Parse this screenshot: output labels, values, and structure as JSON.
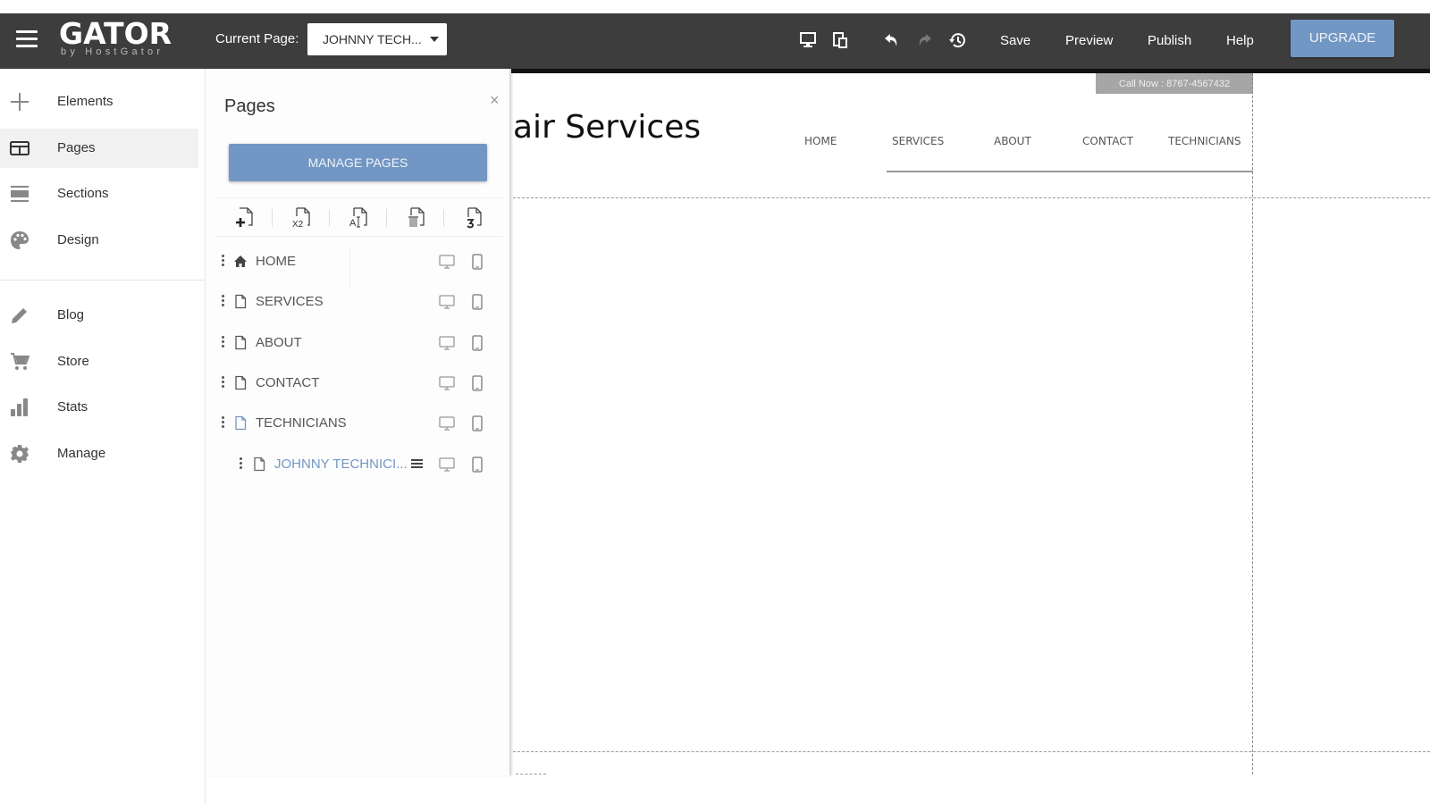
{
  "topbar": {
    "logo_main": "GATOR",
    "logo_sub": "by HostGator",
    "current_page_label": "Current Page:",
    "current_page_value": "JOHNNY TECH...",
    "links": {
      "save": "Save",
      "preview": "Preview",
      "publish": "Publish",
      "help": "Help"
    },
    "upgrade": "UPGRADE",
    "icons": [
      "menu-icon",
      "desktop-view-icon",
      "tablet-mobile-view-icon",
      "undo-icon",
      "redo-icon",
      "history-icon"
    ]
  },
  "sidebar": {
    "items": [
      {
        "label": "Elements",
        "icon": "plus-icon"
      },
      {
        "label": "Pages",
        "icon": "pages-icon",
        "active": true
      },
      {
        "label": "Sections",
        "icon": "sections-icon"
      },
      {
        "label": "Design",
        "icon": "palette-icon"
      },
      {
        "label": "Blog",
        "icon": "pencil-icon"
      },
      {
        "label": "Store",
        "icon": "cart-icon"
      },
      {
        "label": "Stats",
        "icon": "bar-chart-icon"
      },
      {
        "label": "Manage",
        "icon": "gear-icon"
      }
    ]
  },
  "pages_panel": {
    "title": "Pages",
    "close": "×",
    "manage_button": "MANAGE PAGES",
    "tools": [
      "add-page-icon",
      "duplicate-page-icon",
      "rename-page-icon",
      "delete-page-icon",
      "restore-page-icon"
    ],
    "duplicate_tool_text": "X2",
    "rename_tool_text": "A",
    "pages": [
      {
        "label": "HOME",
        "icon": "home-icon"
      },
      {
        "label": "SERVICES",
        "icon": "page-icon"
      },
      {
        "label": "ABOUT",
        "icon": "page-icon"
      },
      {
        "label": "CONTACT",
        "icon": "page-icon"
      },
      {
        "label": "TECHNICIANS",
        "icon": "page-icon"
      },
      {
        "label": "JOHNNY TECHNICI...",
        "icon": "page-icon",
        "current": true,
        "child": true
      }
    ]
  },
  "canvas": {
    "call_now": "Call Now : 8767-4567432",
    "site_title": "air Services",
    "nav": [
      "HOME",
      "SERVICES",
      "ABOUT",
      "CONTACT",
      "TECHNICIANS"
    ]
  },
  "colors": {
    "topbar": "#3d3d3d",
    "accent": "#7397c4",
    "current_page_text": "#7397c4"
  }
}
